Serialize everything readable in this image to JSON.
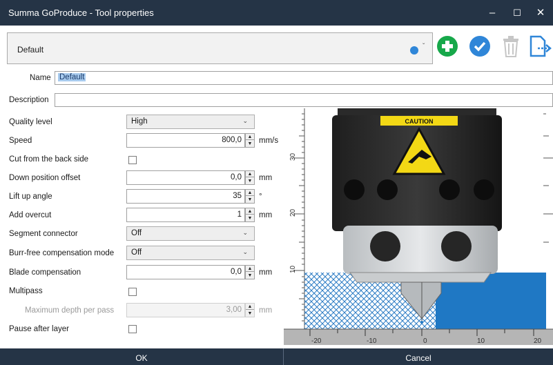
{
  "window": {
    "title": "Summa GoProduce - Tool properties"
  },
  "profile": {
    "selected": "Default"
  },
  "fields": {
    "name_label": "Name",
    "name_value": "Default",
    "description_label": "Description",
    "description_value": ""
  },
  "rows": {
    "quality": {
      "label": "Quality level",
      "value": "High"
    },
    "speed": {
      "label": "Speed",
      "value": "800,0",
      "unit": "mm/s"
    },
    "backside": {
      "label": "Cut from the back side",
      "checked": false
    },
    "down_offset": {
      "label": "Down position offset",
      "value": "0,0",
      "unit": "mm"
    },
    "lift_angle": {
      "label": "Lift up angle",
      "value": "35",
      "unit": "°"
    },
    "overcut": {
      "label": "Add overcut",
      "value": "1",
      "unit": "mm"
    },
    "segment": {
      "label": "Segment connector",
      "value": "Off"
    },
    "burr": {
      "label": "Burr-free compensation mode",
      "value": "Off"
    },
    "blade": {
      "label": "Blade compensation",
      "value": "0,0",
      "unit": "mm"
    },
    "multipass": {
      "label": "Multipass",
      "checked": false
    },
    "max_depth": {
      "label": "Maximum depth per pass",
      "value": "3,00",
      "unit": "mm"
    },
    "pause": {
      "label": "Pause after layer",
      "checked": false
    }
  },
  "preview": {
    "caution": "CAUTION",
    "ruler_v": [
      "30",
      "20",
      "10"
    ],
    "ruler_h": [
      "-20",
      "-10",
      "0",
      "10",
      "20"
    ]
  },
  "footer": {
    "ok": "OK",
    "cancel": "Cancel"
  }
}
